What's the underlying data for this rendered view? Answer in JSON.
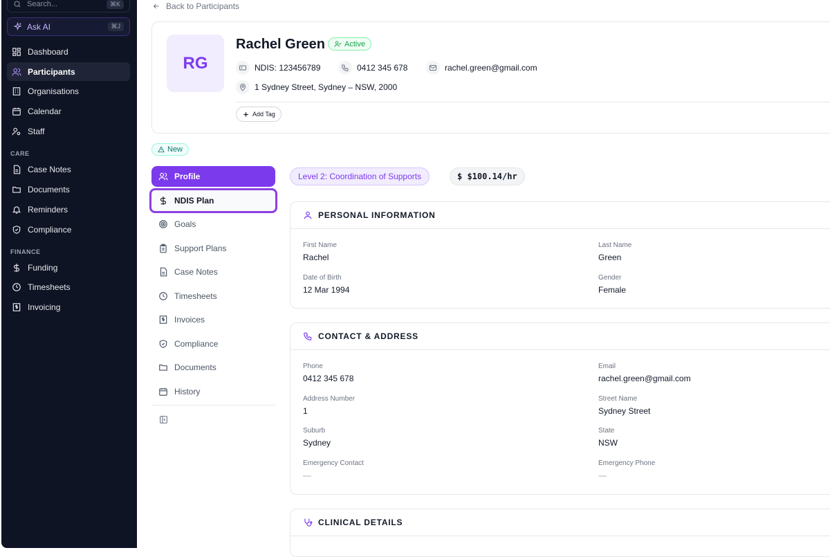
{
  "sidebar": {
    "search_placeholder": "Search...",
    "search_shortcut": "⌘K",
    "ask_ai": "Ask AI",
    "ask_ai_shortcut": "⌘J",
    "items": [
      {
        "label": "Dashboard",
        "icon": "dashboard-icon"
      },
      {
        "label": "Participants",
        "icon": "users-icon",
        "active": true
      },
      {
        "label": "Organisations",
        "icon": "building-icon"
      },
      {
        "label": "Calendar",
        "icon": "calendar-icon"
      },
      {
        "label": "Staff",
        "icon": "staff-icon"
      }
    ],
    "care_label": "CARE",
    "care_items": [
      {
        "label": "Case Notes",
        "icon": "file-text-icon"
      },
      {
        "label": "Documents",
        "icon": "folder-icon"
      },
      {
        "label": "Reminders",
        "icon": "bell-icon"
      },
      {
        "label": "Compliance",
        "icon": "shield-icon"
      }
    ],
    "finance_label": "FINANCE",
    "finance_items": [
      {
        "label": "Funding",
        "icon": "dollar-icon"
      },
      {
        "label": "Timesheets",
        "icon": "clock-icon"
      },
      {
        "label": "Invoicing",
        "icon": "invoice-icon"
      }
    ]
  },
  "back_link": "Back to Participants",
  "participant": {
    "initials": "RG",
    "name": "Rachel Green",
    "status": "Active",
    "ndis": "NDIS: 123456789",
    "phone": "0412 345 678",
    "email": "rachel.green@gmail.com",
    "address": "1 Sydney Street, Sydney – NSW, 2000",
    "add_tag": "Add Tag",
    "new_badge": "New"
  },
  "tabs": [
    {
      "label": "Profile",
      "icon": "users-icon"
    },
    {
      "label": "NDIS Plan",
      "icon": "dollar-icon"
    },
    {
      "label": "Goals",
      "icon": "target-icon"
    },
    {
      "label": "Support Plans",
      "icon": "clipboard-icon"
    },
    {
      "label": "Case Notes",
      "icon": "file-text-icon"
    },
    {
      "label": "Timesheets",
      "icon": "clock-icon"
    },
    {
      "label": "Invoices",
      "icon": "invoice-icon"
    },
    {
      "label": "Compliance",
      "icon": "shield-icon"
    },
    {
      "label": "Documents",
      "icon": "folder-icon"
    },
    {
      "label": "History",
      "icon": "calendar-icon"
    }
  ],
  "support_level": "Level 2: Coordination of Supports",
  "rate": "$ $100.14/hr",
  "personal": {
    "title": "PERSONAL INFORMATION",
    "first_name_label": "First Name",
    "first_name": "Rachel",
    "last_name_label": "Last Name",
    "last_name": "Green",
    "dob_label": "Date of Birth",
    "dob": "12 Mar 1994",
    "gender_label": "Gender",
    "gender": "Female"
  },
  "contact": {
    "title": "CONTACT & ADDRESS",
    "phone_label": "Phone",
    "phone": "0412 345 678",
    "email_label": "Email",
    "email": "rachel.green@gmail.com",
    "address_number_label": "Address Number",
    "address_number": "1",
    "street_label": "Street Name",
    "street": "Sydney Street",
    "suburb_label": "Suburb",
    "suburb": "Sydney",
    "state_label": "State",
    "state": "NSW",
    "emergency_contact_label": "Emergency Contact",
    "emergency_contact": "—",
    "emergency_phone_label": "Emergency Phone",
    "emergency_phone": "—"
  },
  "clinical": {
    "title": "CLINICAL DETAILS"
  },
  "colors": {
    "sidebar_bg": "#0f1424",
    "accent": "#7c3aed",
    "active_status": "#16a34a"
  }
}
